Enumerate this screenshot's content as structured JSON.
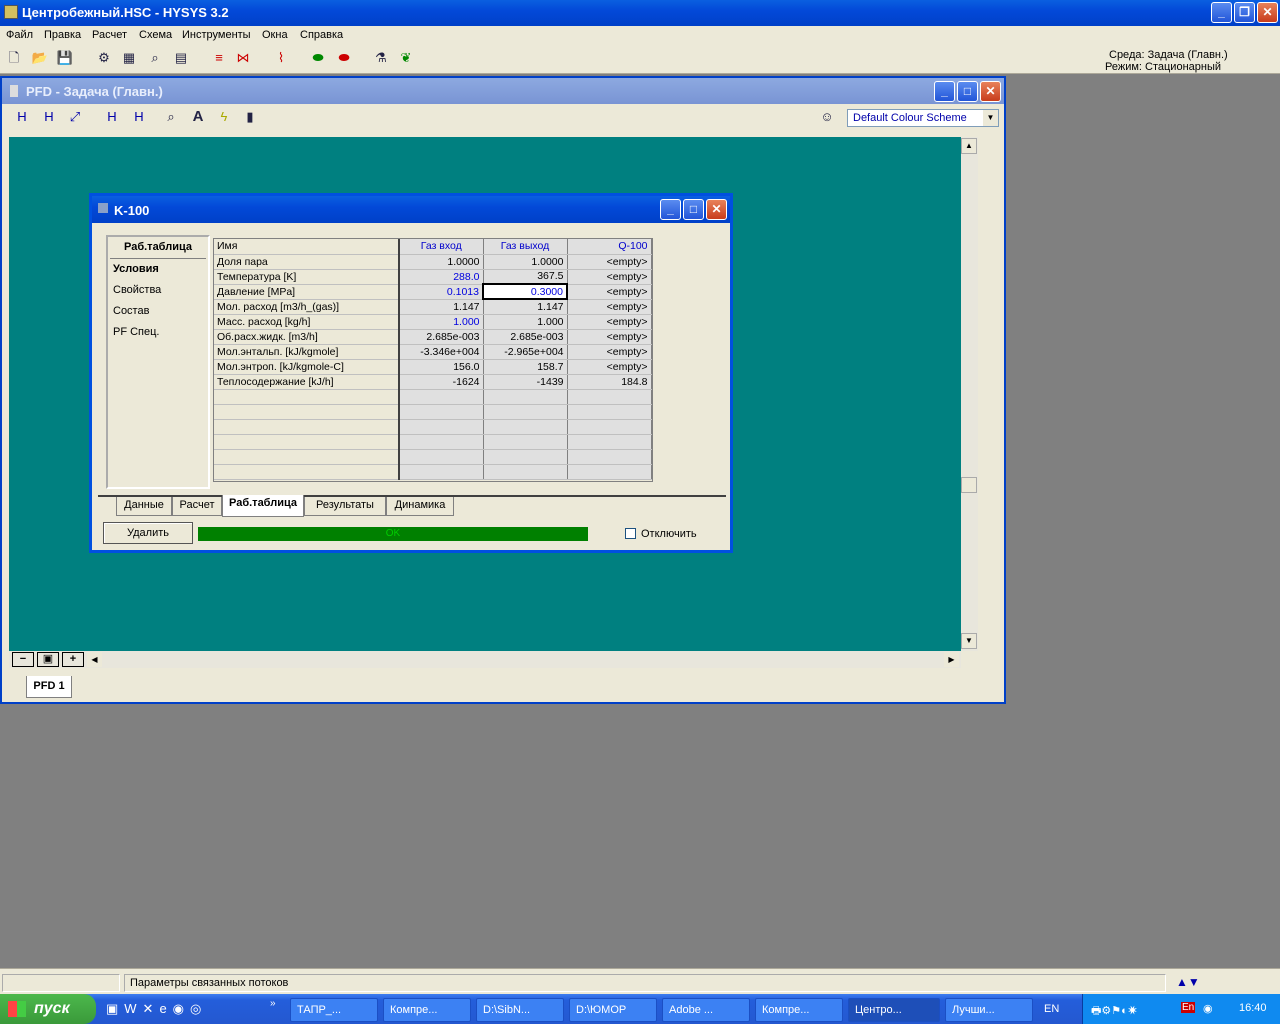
{
  "app": {
    "title": "Центробежный.HSC - HYSYS 3.2",
    "menu": [
      "Файл",
      "Правка",
      "Расчет",
      "Схема",
      "Инструменты",
      "Окна",
      "Справка"
    ],
    "env": "Среда: Задача (Главн.)",
    "mode": "Режим: Стационарный"
  },
  "pfd": {
    "title": "PFD - Задача (Главн.)",
    "colour_scheme": "Default Colour Scheme",
    "tab": "PFD 1"
  },
  "dialog": {
    "title": "K-100",
    "nav": [
      "Раб.таблица",
      "Условия",
      "Свойства",
      "Состав",
      "PF Спец."
    ],
    "columns": [
      "Имя",
      "Газ вход",
      "Газ выход",
      "Q-100"
    ],
    "rows": [
      [
        "Доля пара",
        "1.0000",
        "1.0000",
        "<empty>"
      ],
      [
        "Температура [K]",
        "288.0",
        "367.5",
        "<empty>"
      ],
      [
        "Давление [MPa]",
        "0.1013",
        "0.3000",
        "<empty>"
      ],
      [
        "Мол. расход [m3/h_(gas)]",
        "1.147",
        "1.147",
        "<empty>"
      ],
      [
        "Масс. расход [kg/h]",
        "1.000",
        "1.000",
        "<empty>"
      ],
      [
        "Об.расх.жидк. [m3/h]",
        "2.685e-003",
        "2.685e-003",
        "<empty>"
      ],
      [
        "Мол.энтальп. [kJ/kgmole]",
        "-3.346e+004",
        "-2.965e+004",
        "<empty>"
      ],
      [
        "Мол.энтроп. [kJ/kgmole-C]",
        "156.0",
        "158.7",
        "<empty>"
      ],
      [
        "Теплосодержание [kJ/h]",
        "-1624",
        "-1439",
        "184.8"
      ]
    ],
    "tabs": [
      "Данные",
      "Расчет",
      "Раб.таблица",
      "Результаты",
      "Динамика"
    ],
    "delete_label": "Удалить",
    "status": "OK",
    "disable_label": "Отключить"
  },
  "statusbar": {
    "text": "Параметры связанных потоков"
  },
  "taskbar": {
    "start": "пуск",
    "tasks": [
      "ТАПР_...",
      "Компре...",
      "D:\\SibN...",
      "D:\\ЮМОР",
      "Adobe ...",
      "Компре...",
      "Центро...",
      "Лучши..."
    ],
    "lang": "EN",
    "tray_lang": "En",
    "clock": "16:40"
  }
}
